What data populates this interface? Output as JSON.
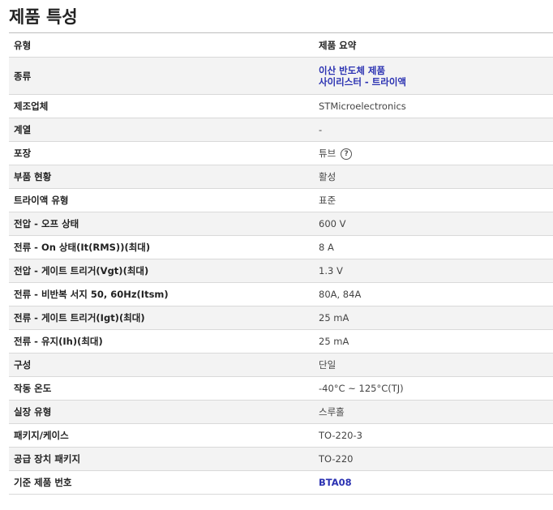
{
  "section_title": "제품 특성",
  "header": {
    "col1": "유형",
    "col2": "제품 요약"
  },
  "rows": [
    {
      "attr": "종류",
      "links": [
        "이산 반도체 제품",
        "사이리스터 - 트라이액"
      ]
    },
    {
      "attr": "제조업체",
      "value": "STMicroelectronics"
    },
    {
      "attr": "계열",
      "value": "-"
    },
    {
      "attr": "포장",
      "value": "튜브",
      "help_icon": "question-circle-icon",
      "help_glyph": "?"
    },
    {
      "attr": "부품 현황",
      "value": "활성"
    },
    {
      "attr": "트라이액 유형",
      "value": "표준"
    },
    {
      "attr": "전압 - 오프 상태",
      "value": "600 V"
    },
    {
      "attr": "전류 - On 상태(It(RMS))(최대)",
      "value": "8 A"
    },
    {
      "attr": "전압 - 게이트 트리거(Vgt)(최대)",
      "value": "1.3 V"
    },
    {
      "attr": "전류 - 비반복 서지 50, 60Hz(Itsm)",
      "value": "80A, 84A"
    },
    {
      "attr": "전류 - 게이트 트리거(Igt)(최대)",
      "value": "25 mA"
    },
    {
      "attr": "전류 - 유지(Ih)(최대)",
      "value": "25 mA"
    },
    {
      "attr": "구성",
      "value": "단일"
    },
    {
      "attr": "작동 온도",
      "value": "-40°C ~ 125°C(TJ)"
    },
    {
      "attr": "실장 유형",
      "value": "스루홀"
    },
    {
      "attr": "패키지/케이스",
      "value": "TO-220-3"
    },
    {
      "attr": "공급 장치 패키지",
      "value": "TO-220"
    },
    {
      "attr": "기준 제품 번호",
      "link": "BTA08"
    }
  ],
  "colors": {
    "link": "#2b32b2",
    "row_alt": "#f3f3f3",
    "border": "#d9d9d9"
  }
}
